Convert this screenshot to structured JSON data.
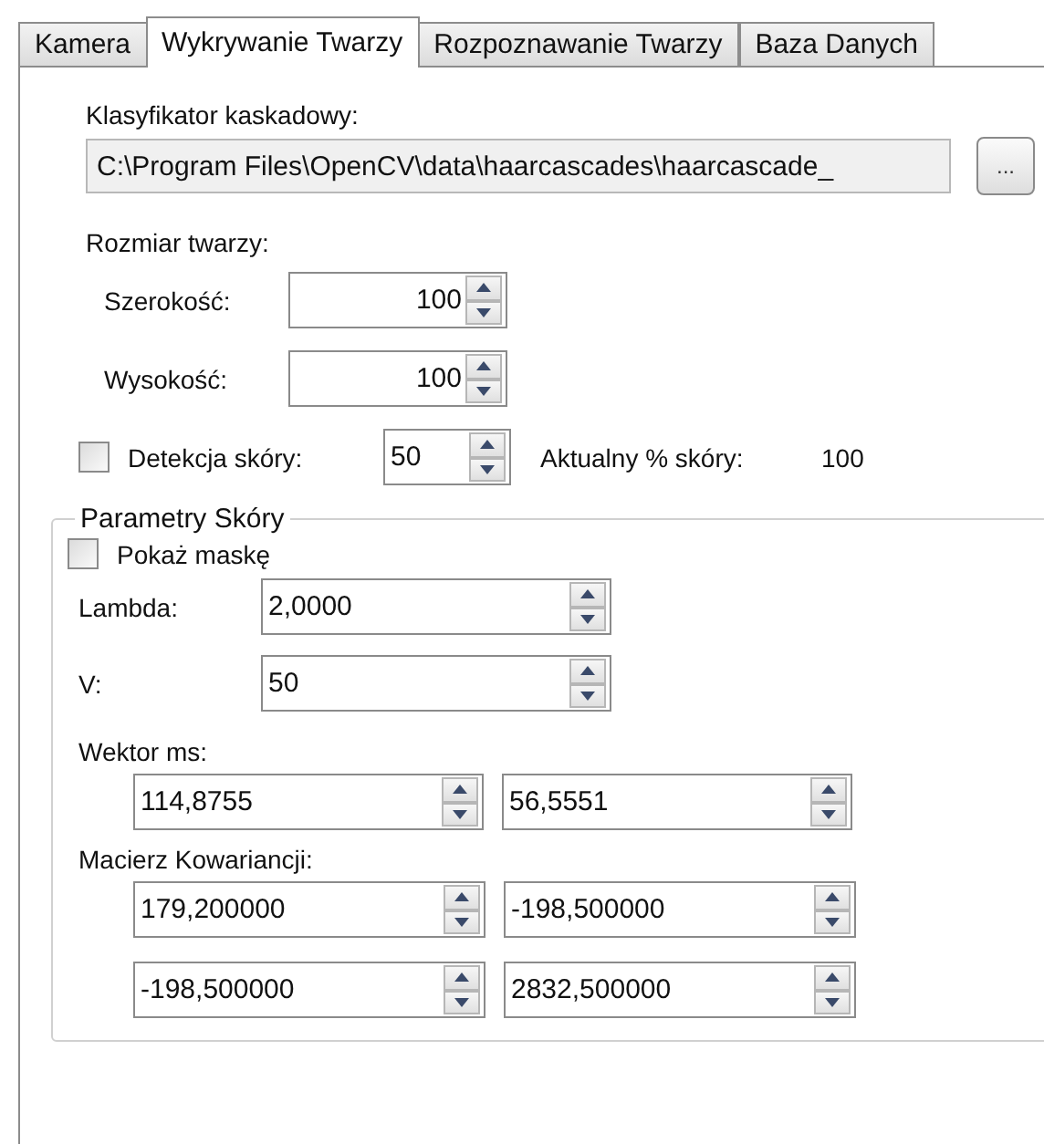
{
  "tabs": [
    {
      "label": "Kamera",
      "selected": false
    },
    {
      "label": "Wykrywanie Twarzy",
      "selected": true
    },
    {
      "label": "Rozpoznawanie Twarzy",
      "selected": false
    },
    {
      "label": "Baza Danych",
      "selected": false
    }
  ],
  "classifier": {
    "label": "Klasyfikator kaskadowy:",
    "path": "C:\\Program Files\\OpenCV\\data\\haarcascades\\haarcascade_",
    "browse_button": "..."
  },
  "face_size": {
    "label": "Rozmiar twarzy:",
    "fields": [
      {
        "label": "Szerokość:",
        "value": "100"
      },
      {
        "label": "Wysokość:",
        "value": "100"
      }
    ]
  },
  "skin_detection": {
    "label": "Detekcja skóry:",
    "checked": false,
    "value": "50",
    "current_label": "Aktualny % skóry:",
    "current_value": "100"
  },
  "skin_params": {
    "title": "Parametry Skóry",
    "show_mask": {
      "label": "Pokaż maskę",
      "checked": false
    },
    "fields": [
      {
        "label": "Lambda:",
        "value": "2,0000"
      },
      {
        "label": "V:",
        "value": "50"
      }
    ],
    "vector": {
      "label": "Wektor ms:",
      "values": [
        "114,8755",
        "56,5551"
      ]
    },
    "covariance": {
      "label": "Macierz Kowariancji:",
      "rows": [
        [
          "179,200000",
          "-198,500000"
        ],
        [
          "-198,500000",
          "2832,500000"
        ]
      ]
    }
  }
}
